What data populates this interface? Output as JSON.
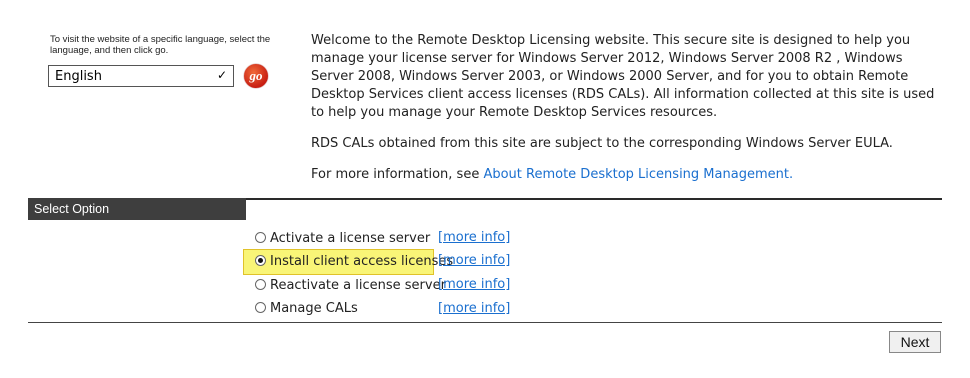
{
  "language": {
    "help_text": "To visit the website of a specific language, select the language, and then click go.",
    "selected": "English",
    "go_label": "go"
  },
  "intro": {
    "paragraph1": "Welcome to the Remote Desktop Licensing website. This secure site is designed to help you manage your license server for Windows Server 2012, Windows Server 2008 R2 , Windows Server 2008, Windows Server 2003, or Windows 2000 Server, and for you to obtain Remote Desktop Services client access licenses (RDS CALs). All information collected at this site is used to help you manage your Remote Desktop Services resources.",
    "paragraph2": "RDS CALs obtained from this site are subject to the corresponding Windows Server EULA.",
    "paragraph3_prefix": "For more information, see ",
    "paragraph3_link": "About Remote Desktop Licensing Management."
  },
  "select_option": {
    "title": "Select Option",
    "options": [
      {
        "label": "Activate a license server",
        "more": "[more info]",
        "checked": false
      },
      {
        "label": "Install client access licenses",
        "more": "[more info]",
        "checked": true
      },
      {
        "label": "Reactivate a license server",
        "more": "[more info]",
        "checked": false
      },
      {
        "label": "Manage CALs",
        "more": "[more info]",
        "checked": false
      }
    ]
  },
  "next_label": "Next"
}
